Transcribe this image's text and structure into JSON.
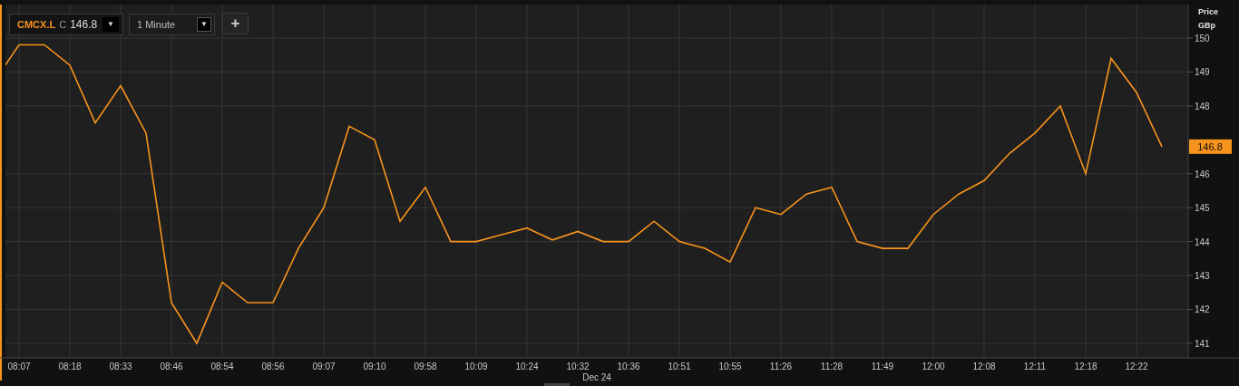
{
  "toolbar": {
    "symbol": "CMCX.L",
    "close_label": "C",
    "close_value": "146.8",
    "symbol_arrow": "▼",
    "interval": "1 Minute",
    "interval_arrow": "▼",
    "add_button": "+"
  },
  "price_axis": {
    "title": "Price",
    "unit": "GBp",
    "last_price": "146.8"
  },
  "date_label": "Dec 24",
  "chart_data": {
    "type": "line",
    "grid": true,
    "ylim": [
      140.57,
      150.99
    ],
    "yticks": [
      141,
      142,
      143,
      144,
      145,
      146,
      148,
      149,
      150
    ],
    "categories": [
      null,
      "08:07",
      null,
      "08:18",
      null,
      "08:33",
      null,
      "08:46",
      null,
      "08:54",
      null,
      "08:56",
      null,
      "09:07",
      null,
      "09:10",
      null,
      "09:58",
      null,
      "10:09",
      null,
      "10:24",
      null,
      "10:32",
      null,
      "10:36",
      null,
      "10:51",
      null,
      "10:55",
      null,
      "11:26",
      null,
      "11:28",
      null,
      "11:49",
      null,
      "12:00",
      null,
      "12:08",
      null,
      "12:11",
      null,
      "12:18",
      null,
      "12:22",
      null
    ],
    "series": [
      {
        "color": "#f7941d",
        "values": [
          148.7,
          149.8,
          149.8,
          149.2,
          147.5,
          148.6,
          147.2,
          142.2,
          141.0,
          142.8,
          142.2,
          142.2,
          143.8,
          145.0,
          147.4,
          147.0,
          144.6,
          145.6,
          144.0,
          144.0,
          144.2,
          144.4,
          144.05,
          144.3,
          144.0,
          144.0,
          144.6,
          144.0,
          143.8,
          143.4,
          145.0,
          144.8,
          145.4,
          145.6,
          144.0,
          143.8,
          143.8,
          144.8,
          145.4,
          145.8,
          146.6,
          147.2,
          148.0,
          146.0,
          149.4,
          148.4,
          146.8
        ]
      }
    ]
  }
}
